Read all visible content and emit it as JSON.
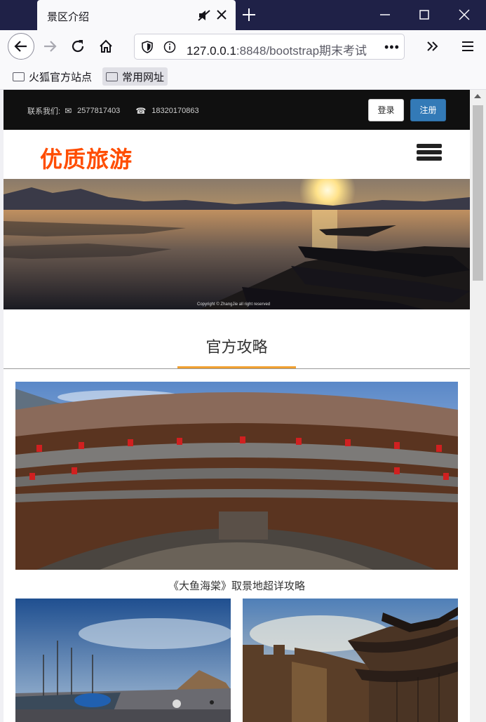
{
  "browser": {
    "tab_title": "景区介绍",
    "url_host": "127.0.0.1",
    "url_path": ":8848/bootstrap期末考试",
    "url_more": "•••",
    "bookmarks": [
      {
        "label": "火狐官方站点",
        "icon": "folder-icon"
      },
      {
        "label": "常用网址",
        "icon": "folder-icon"
      }
    ],
    "icons": [
      "back-icon",
      "forward-icon",
      "reload-icon",
      "home-icon",
      "shield-icon",
      "info-icon",
      "mute-icon",
      "close-icon",
      "plus-icon",
      "minimize-icon",
      "maximize-icon",
      "overflow-icon",
      "menu-icon"
    ]
  },
  "page": {
    "contact": {
      "label": "联系我们:",
      "qq": "2577817403",
      "phone": "18320170863",
      "qq_icon": "envelope-icon",
      "phone_icon": "phone-icon"
    },
    "login_label": "登录",
    "register_label": "注册",
    "logo_text": "优质旅游",
    "banner_copyright": "Copyright © ZhangJie all right reserved",
    "section_title": "官方攻略",
    "feature_caption": "《大鱼海棠》取景地超详攻略"
  },
  "colors": {
    "accent_orange": "#ff4d00",
    "underline": "#f0a030",
    "register_blue": "#337ab7",
    "tabbar": "#1f2147"
  }
}
